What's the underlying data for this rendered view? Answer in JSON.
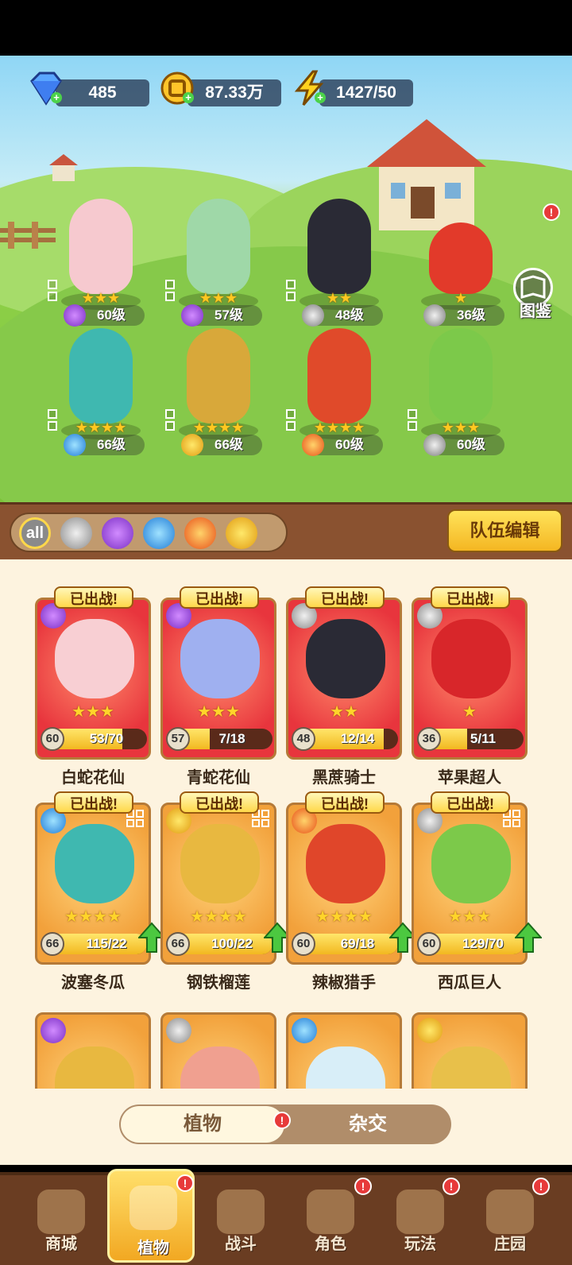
{
  "resources": {
    "gems": "485",
    "gold": "87.33万",
    "energy": "1427/50"
  },
  "codex": {
    "label": "图鉴"
  },
  "team": [
    {
      "level": "60级",
      "stars": "★★★",
      "element": "poison"
    },
    {
      "level": "57级",
      "stars": "★★★",
      "element": "poison"
    },
    {
      "level": "48级",
      "stars": "★★",
      "element": "metal"
    },
    {
      "level": "36级",
      "stars": "★",
      "element": "metal"
    },
    {
      "level": "66级",
      "stars": "★★★★",
      "element": "water"
    },
    {
      "level": "66级",
      "stars": "★★★★",
      "element": "lightning"
    },
    {
      "level": "60级",
      "stars": "★★★★",
      "element": "fire"
    },
    {
      "level": "60级",
      "stars": "★★★",
      "element": "metal"
    }
  ],
  "filters": {
    "all_label": "all",
    "icons": [
      "metal-icon",
      "poison-icon",
      "water-icon",
      "fire-icon",
      "lightning-icon"
    ]
  },
  "team_edit_label": "队伍编辑",
  "deployed_label": "已出战!",
  "cards": [
    {
      "name": "白蛇花仙",
      "level": "60",
      "progress": "53/70",
      "stars": "★★★",
      "fill": 0.76
    },
    {
      "name": "青蛇花仙",
      "level": "57",
      "progress": "7/18",
      "stars": "★★★",
      "fill": 0.39
    },
    {
      "name": "黑蔗骑士",
      "level": "48",
      "progress": "12/14",
      "stars": "★★",
      "fill": 0.86
    },
    {
      "name": "苹果超人",
      "level": "36",
      "progress": "5/11",
      "stars": "★",
      "fill": 0.45
    },
    {
      "name": "波塞冬瓜",
      "level": "66",
      "progress": "115/22",
      "stars": "★★★★",
      "fill": 1
    },
    {
      "name": "钢铁榴莲",
      "level": "66",
      "progress": "100/22",
      "stars": "★★★★",
      "fill": 1
    },
    {
      "name": "辣椒猎手",
      "level": "60",
      "progress": "69/18",
      "stars": "★★★★",
      "fill": 1
    },
    {
      "name": "西瓜巨人",
      "level": "60",
      "progress": "129/70",
      "stars": "★★★",
      "fill": 1
    }
  ],
  "tabs": {
    "plants": "植物",
    "hybrid": "杂交"
  },
  "nav": {
    "shop": "商城",
    "plants": "植物",
    "battle": "战斗",
    "character": "角色",
    "gameplay": "玩法",
    "manor": "庄园"
  },
  "badge": "!"
}
